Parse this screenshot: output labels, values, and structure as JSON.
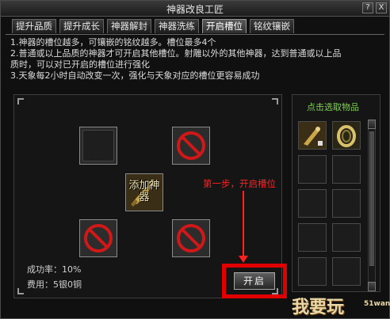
{
  "window": {
    "title": "神器改良工匠",
    "help_label": "?",
    "close_label": "X"
  },
  "tabs": [
    {
      "label": "提升品质"
    },
    {
      "label": "提升成长"
    },
    {
      "label": "神器解封"
    },
    {
      "label": "神器洗练"
    },
    {
      "label": "开启槽位",
      "active": true
    },
    {
      "label": "铭纹镶嵌"
    }
  ],
  "description": [
    "1.神器的槽位越多，可镶嵌的铭纹越多。槽位最多4个",
    "2.普通或以上品质的神器才可开启其他槽位。射雕以外的其他神器，达到普通或以上品",
    "质时，可以对已开启的槽位进行强化",
    "3.天象每2小时自动改变一次，强化与天象对应的槽位更容易成功"
  ],
  "center_slot": {
    "label": "添加神器"
  },
  "stats": {
    "success_rate": "成功率：10%",
    "cost": "费用：5银0铜"
  },
  "open_button": {
    "label": "开启"
  },
  "annotation": {
    "text": "第一步，开启槽位"
  },
  "side_panel": {
    "header": "点击选取物品"
  },
  "watermark": {
    "text": "我要玩",
    "sub": "51wan"
  },
  "colors": {
    "accent_green": "#7cd24c",
    "annotation_red": "#ff2020",
    "forbidden_red": "#d01818"
  }
}
